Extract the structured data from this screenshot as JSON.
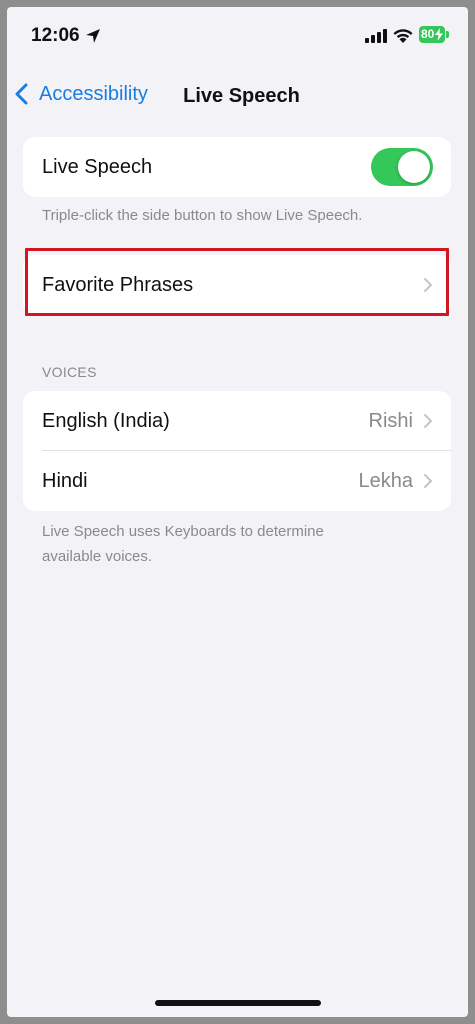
{
  "status_bar": {
    "time": "12:06",
    "battery": "80"
  },
  "nav": {
    "back_label": "Accessibility",
    "title": "Live Speech"
  },
  "live_speech_group": {
    "label": "Live Speech",
    "toggle_on": true,
    "footer": "Triple-click the side button to show Live Speech."
  },
  "favorites_group": {
    "label": "Favorite Phrases"
  },
  "voices": {
    "header": "VOICES",
    "items": [
      {
        "label": "English (India)",
        "value": "Rishi"
      },
      {
        "label": "Hindi",
        "value": "Lekha"
      }
    ],
    "footer": "Live Speech uses Keyboards to determine available voices."
  },
  "colors": {
    "accent": "#1a7de0",
    "toggle_on": "#34c759",
    "highlight": "#d0161e",
    "background": "#f2f2f7"
  }
}
